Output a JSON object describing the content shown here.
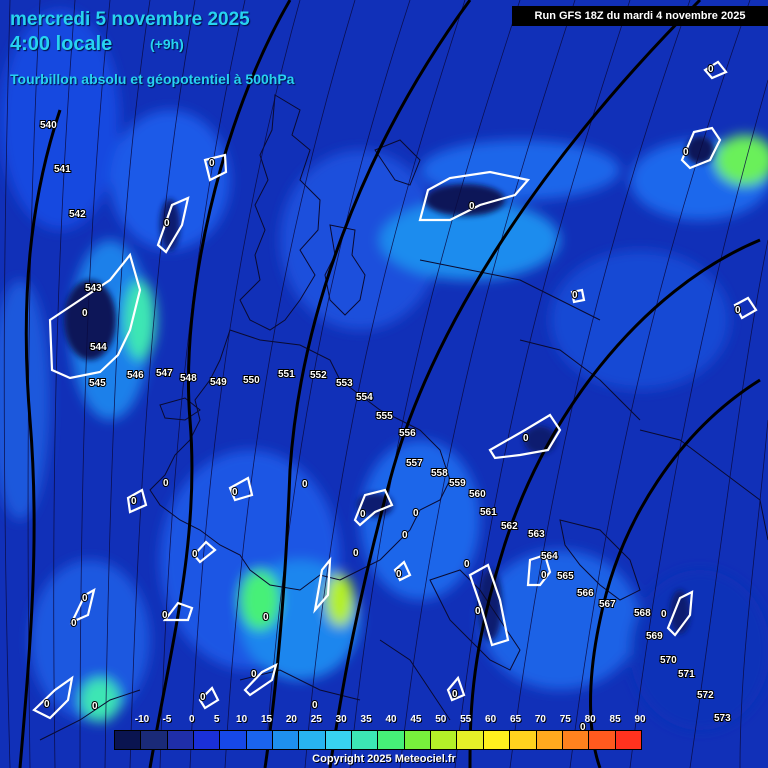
{
  "header": {
    "date": "mercredi 5 novembre 2025",
    "time": "4:00 locale",
    "offset": "(+9h)",
    "product": "Tourbillon absolu et géopotentiel à 500hPa"
  },
  "run": "Run GFS 18Z du mardi 4 novembre 2025",
  "copyright": "Copyright 2025 Meteociel.fr",
  "legend": {
    "ticks": [
      "-10",
      "-5",
      "0",
      "5",
      "10",
      "15",
      "20",
      "25",
      "30",
      "35",
      "40",
      "45",
      "50",
      "55",
      "60",
      "65",
      "70",
      "75",
      "80",
      "85",
      "90"
    ],
    "colors": [
      "#0a1450",
      "#1a2a78",
      "#1f2ea8",
      "#1a30d8",
      "#1648e8",
      "#1a64ee",
      "#1e90ee",
      "#28b4f0",
      "#38d2f0",
      "#3ce6b4",
      "#46f078",
      "#78f03c",
      "#b4f028",
      "#e6f028",
      "#fff01e",
      "#ffd21e",
      "#ffaa1e",
      "#ff821e",
      "#ff5a1e",
      "#ff321e"
    ]
  },
  "geopotential_labels": [
    {
      "text": "540"
    },
    {
      "text": "541"
    },
    {
      "text": "542"
    },
    {
      "text": "543"
    },
    {
      "text": "544"
    },
    {
      "text": "545"
    },
    {
      "text": "546"
    },
    {
      "text": "547"
    },
    {
      "text": "548"
    },
    {
      "text": "549"
    },
    {
      "text": "550"
    },
    {
      "text": "551"
    },
    {
      "text": "552"
    },
    {
      "text": "553"
    },
    {
      "text": "554"
    },
    {
      "text": "555"
    },
    {
      "text": "556"
    },
    {
      "text": "557"
    },
    {
      "text": "558"
    },
    {
      "text": "559"
    },
    {
      "text": "560"
    },
    {
      "text": "561"
    },
    {
      "text": "562"
    },
    {
      "text": "563"
    },
    {
      "text": "564"
    },
    {
      "text": "565"
    },
    {
      "text": "566"
    },
    {
      "text": "567"
    },
    {
      "text": "568"
    },
    {
      "text": "569"
    },
    {
      "text": "570"
    },
    {
      "text": "571"
    },
    {
      "text": "572"
    },
    {
      "text": "573"
    }
  ],
  "zero_label": "0"
}
